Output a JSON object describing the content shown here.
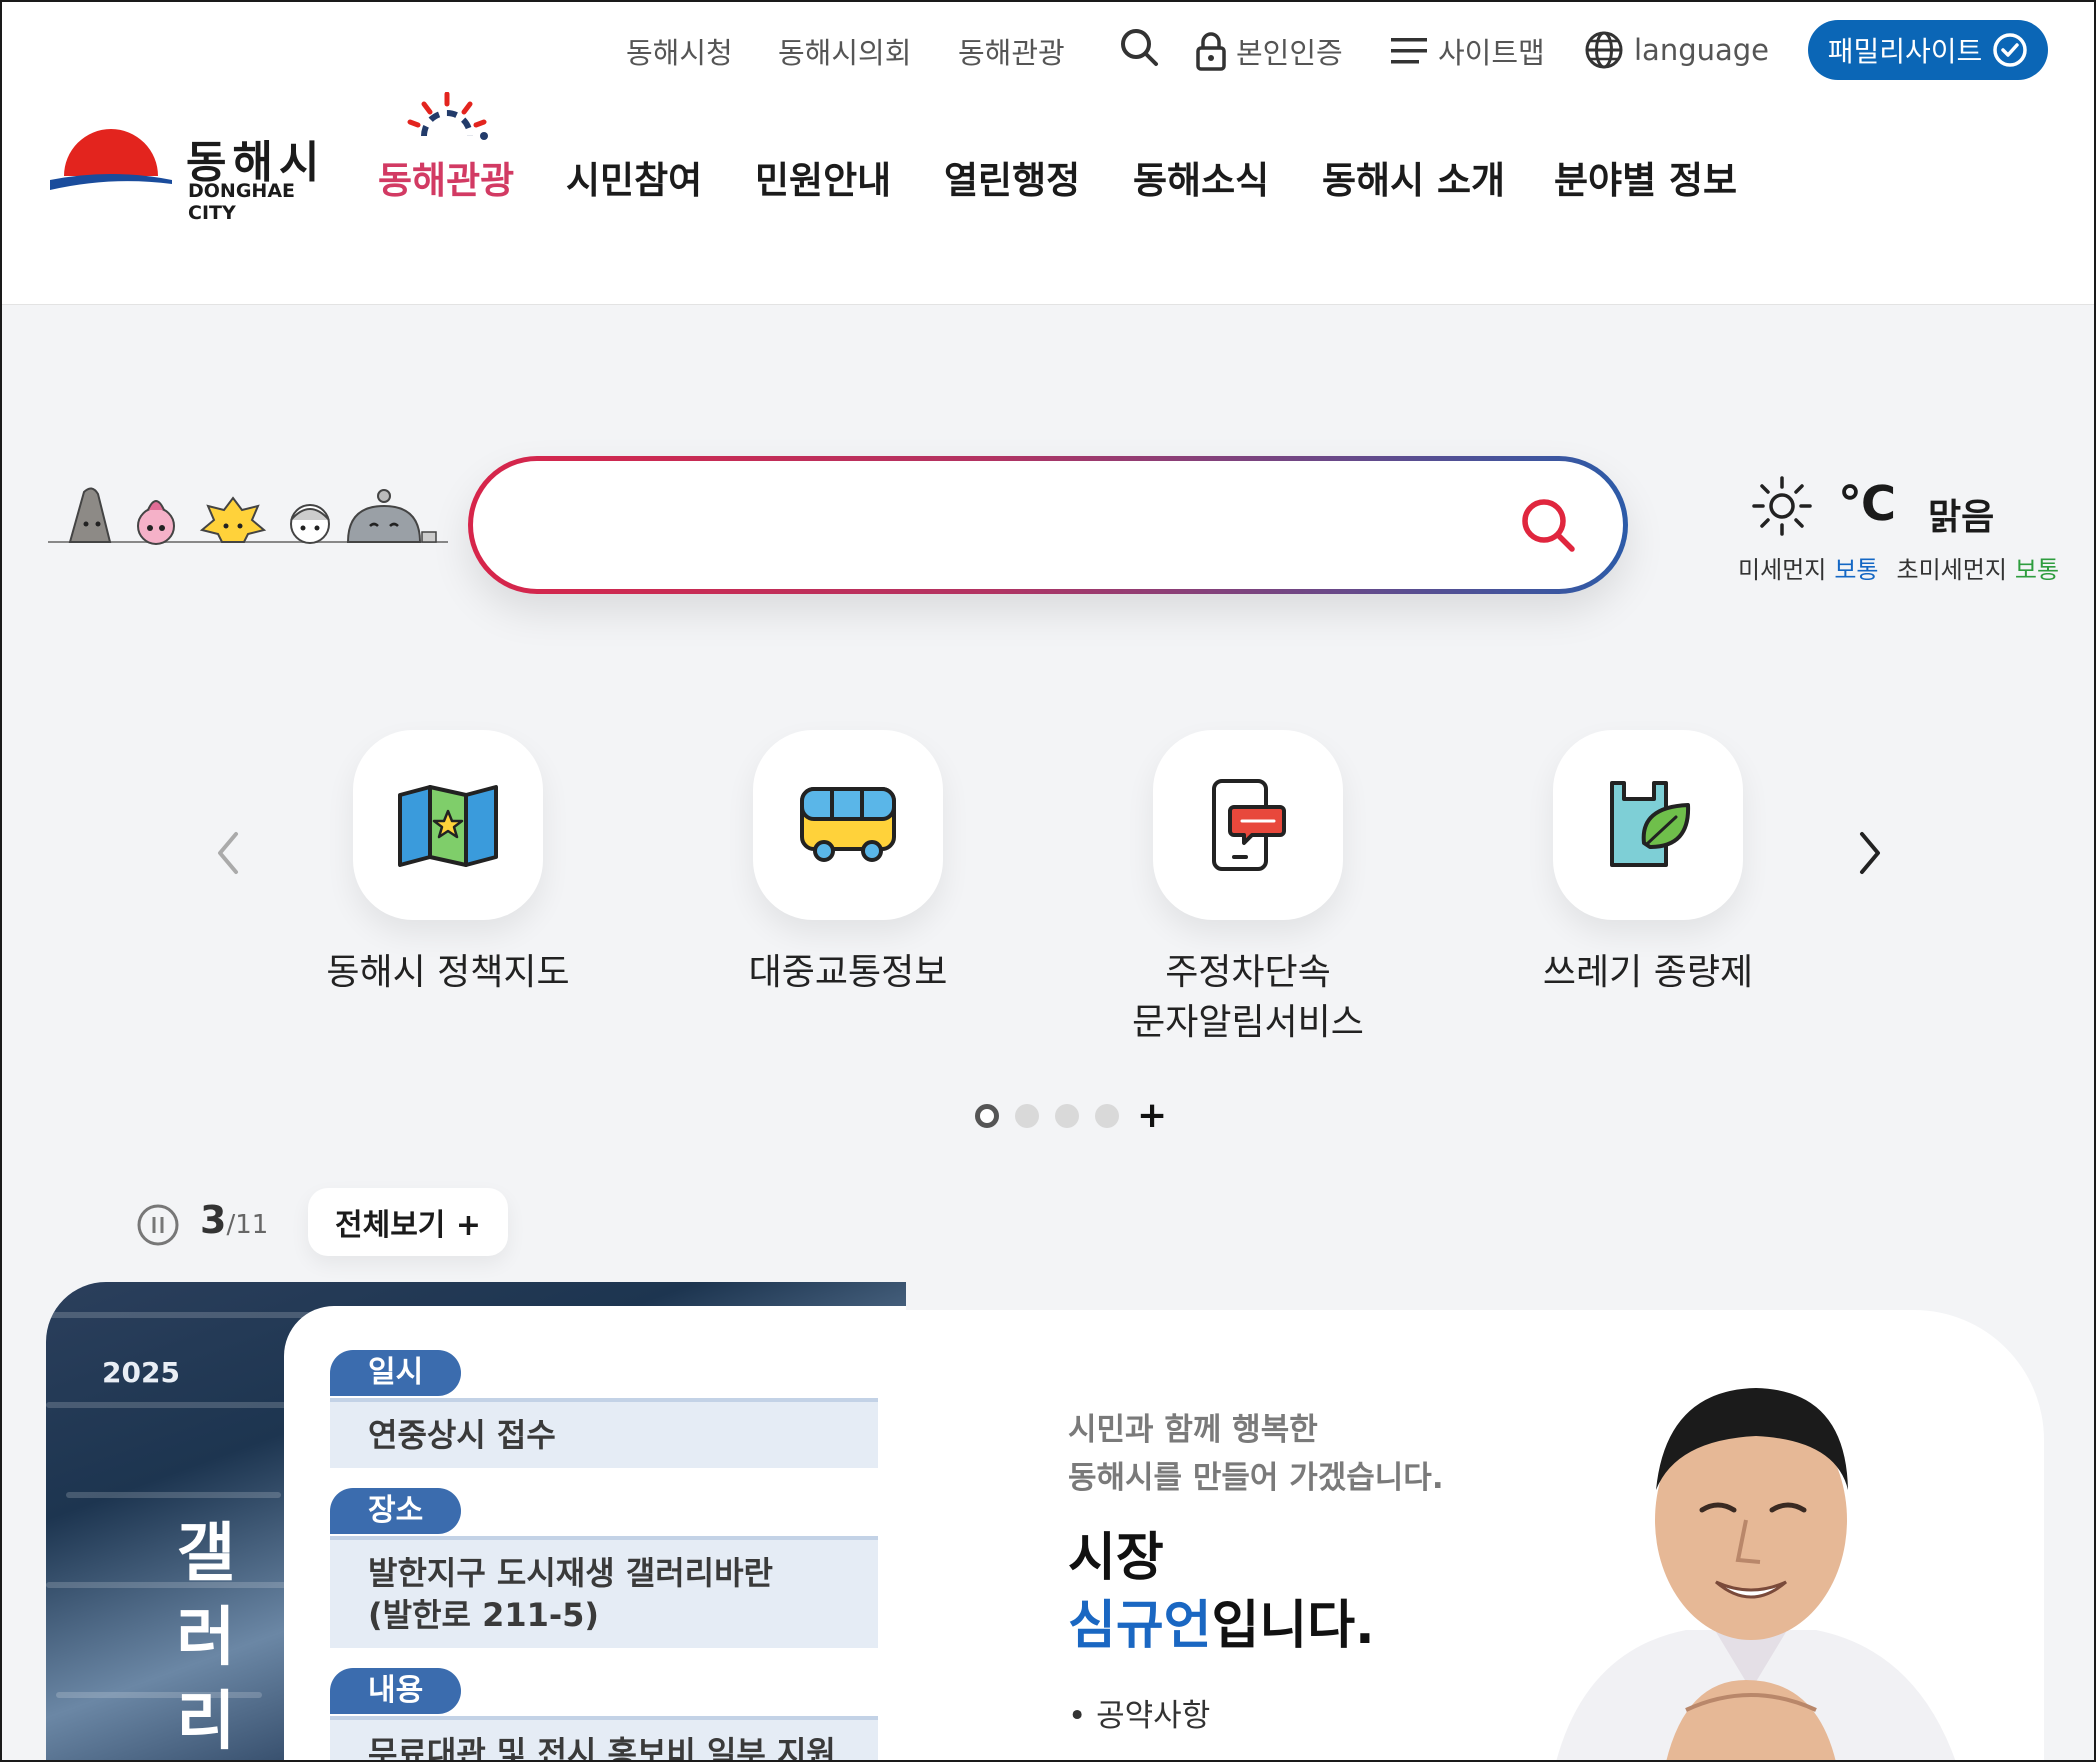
{
  "utility": {
    "links": [
      "동해시청",
      "동해시의회",
      "동해관광"
    ],
    "auth_label": "본인인증",
    "sitemap_label": "사이트맵",
    "language_label": "language",
    "family_site_label": "패밀리사이트"
  },
  "logo": {
    "korean": "동해시",
    "english": "DONGHAE CITY"
  },
  "gnb": [
    "동해관광",
    "시민참여",
    "민원안내",
    "열린행정",
    "동해소식",
    "동해시 소개",
    "분야별 정보"
  ],
  "search": {
    "placeholder": ""
  },
  "weather": {
    "temperature": "℃",
    "sky": "맑음",
    "pm10_label": "미세먼지",
    "pm10_level": "보통",
    "pm25_label": "초미세먼지",
    "pm25_level": "보통"
  },
  "quick_menu": {
    "items": [
      {
        "label": "동해시 정책지도",
        "icon": "map-icon"
      },
      {
        "label": "대중교통정보",
        "icon": "bus-icon"
      },
      {
        "label": "주정차단속\n문자알림서비스",
        "icon": "phone-message-icon"
      },
      {
        "label": "쓰레기 종량제",
        "icon": "trash-bag-icon"
      }
    ],
    "active_page": 1,
    "page_count": 4
  },
  "banner": {
    "current": "3",
    "total": "/11",
    "view_all_label": "전체보기 +",
    "year": "2025",
    "vertical_title": "갤러리",
    "rows": [
      {
        "tag": "일시",
        "text": "연중상시 접수"
      },
      {
        "tag": "장소",
        "text": "발한지구 도시재생 갤러리바란\n(발한로 211-5)"
      },
      {
        "tag": "내용",
        "text": "무료대관 및 전시 홍보비 일부 지원"
      }
    ]
  },
  "mayor": {
    "subtitle_line1": "시민과 함께 행복한",
    "subtitle_line2": "동해시를 만들어 가겠습니다.",
    "title_line1": "시장",
    "name": "심규언",
    "title_suffix": "입니다.",
    "pledge_link": "공약사항"
  }
}
